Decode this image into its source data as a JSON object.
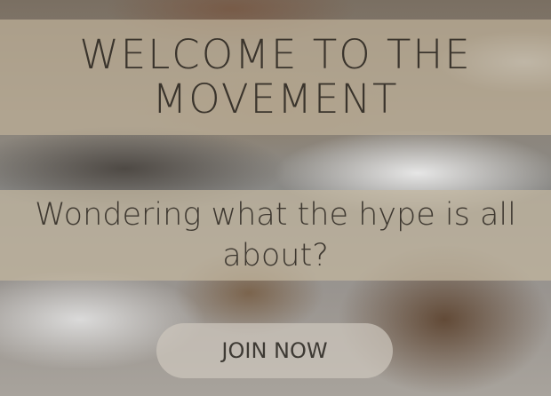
{
  "hero": {
    "headline": "WELCOME TO THE MOVEMENT",
    "subheadline": "Wondering what the hype is all about?",
    "cta_label": "JOIN NOW"
  },
  "colors": {
    "band_tint": "#c3b7a0",
    "text_dark": "#3a342c",
    "button_fill": "#cdc6bc"
  }
}
